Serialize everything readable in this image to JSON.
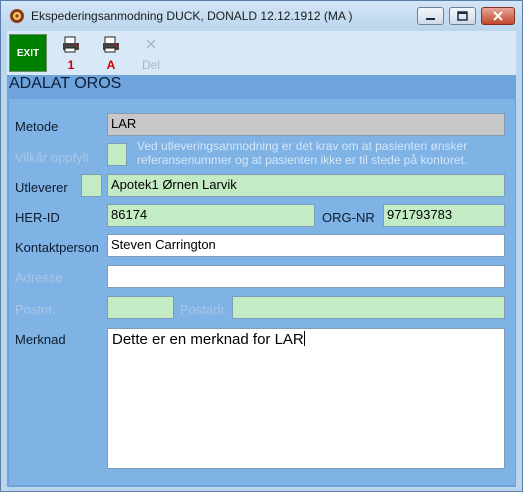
{
  "window": {
    "title": "Ekspederingsanmodning DUCK, DONALD 12.12.1912 (MA  )"
  },
  "toolbar": {
    "exit_label": "EXIT",
    "print1_label": "1",
    "printA_label": "A",
    "delete_label": "Del"
  },
  "header": {
    "title": "ADALAT OROS"
  },
  "form": {
    "metode_label": "Metode",
    "metode_value": "LAR",
    "vilkar_label": "Vilkår  oppfylt",
    "vilkar_note": "Ved utleveringsanmodning er det krav om at pasienten ønsker referansenummer og at pasienten ikke er til stede på kontoret.",
    "utleverer_label": "Utleverer",
    "utleverer_value": "Apotek1 Ørnen Larvik",
    "herid_label": "HER-ID",
    "herid_value": "86174",
    "orgnr_label": "ORG-NR",
    "orgnr_value": "971793783",
    "kontakt_label": "Kontaktperson",
    "kontakt_value": "Steven Carrington",
    "adresse_label": "Adresse",
    "adresse_value": "",
    "postnr_label": "Postnr.",
    "postnr_value": "",
    "postadr_label": "Postadr.",
    "postadr_value": "",
    "merknad_label": "Merknad",
    "merknad_value": "Dette er en merknad for LAR"
  }
}
